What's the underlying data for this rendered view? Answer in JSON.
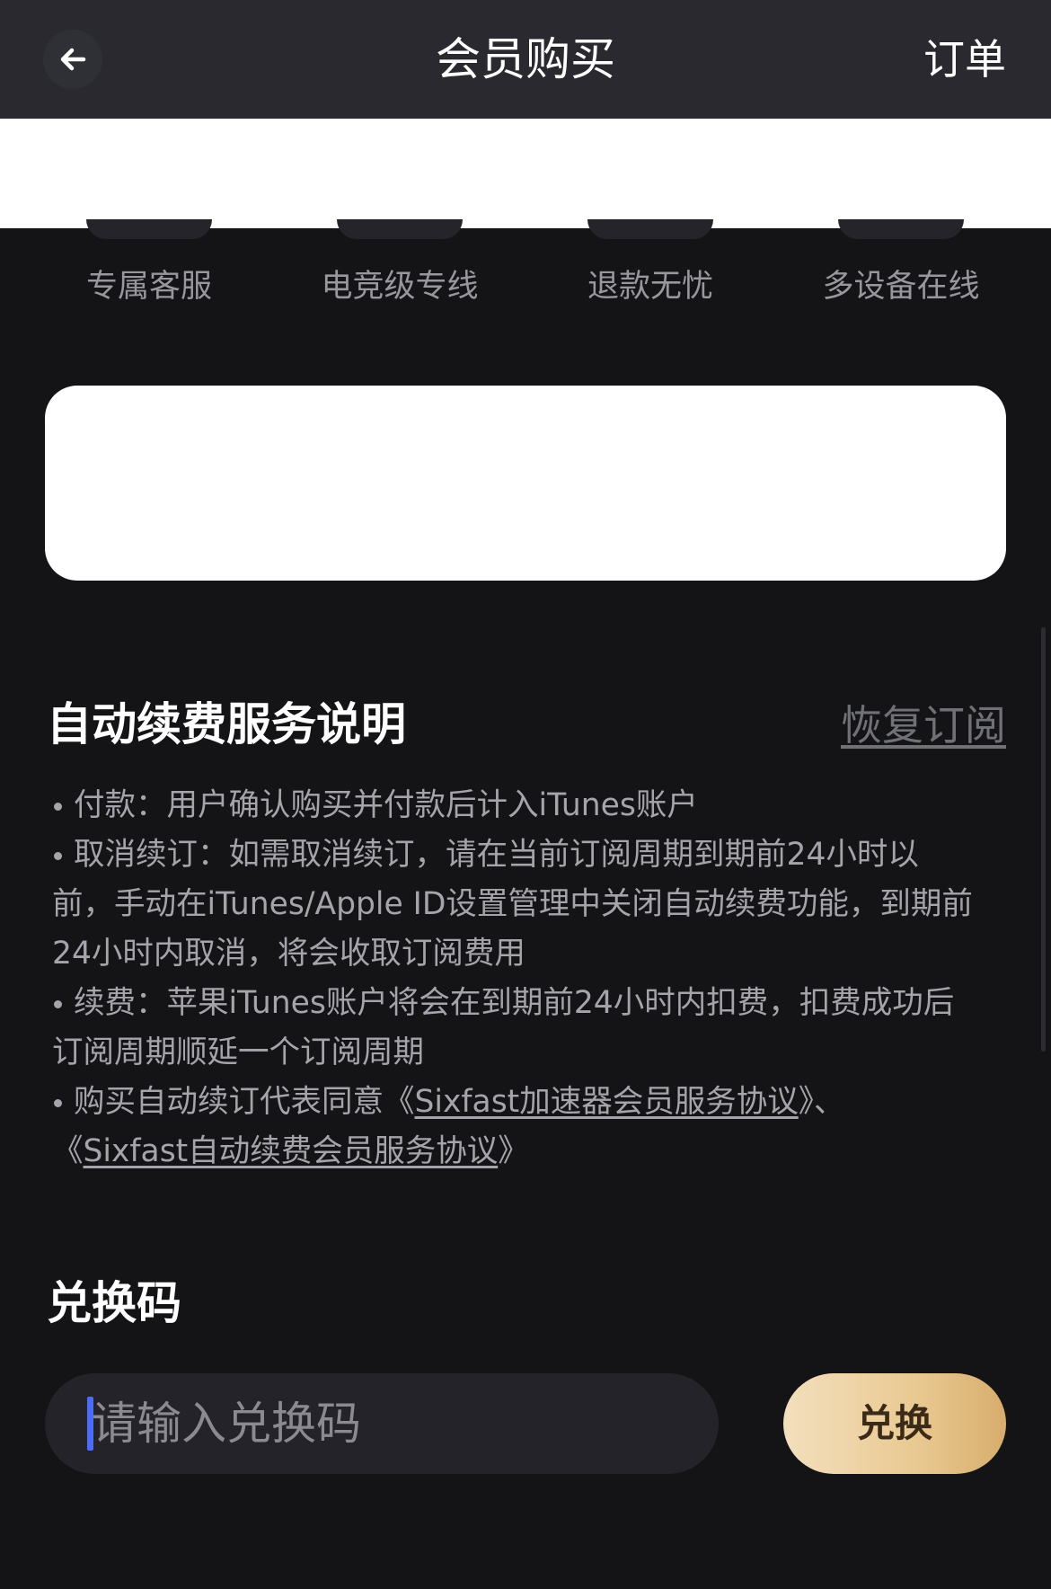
{
  "nav": {
    "title": "会员购买",
    "orders_label": "订单",
    "back_icon": "arrow-left-icon"
  },
  "features": [
    {
      "label": "专属客服"
    },
    {
      "label": "电竞级专线"
    },
    {
      "label": "退款无忧"
    },
    {
      "label": "多设备在线"
    }
  ],
  "renewal": {
    "title": "自动续费服务说明",
    "restore_label": "恢复订阅",
    "notes": {
      "payment": "付款：用户确认购买并付款后计入iTunes账户",
      "cancel_line1": "取消续订：如需取消续订，请在当前订阅周期到期前24小时以",
      "cancel_line2": "前，手动在iTunes/Apple ID设置管理中关闭自动续费功能，到期前",
      "cancel_line3": "24小时内取消，将会收取订阅费用",
      "fee_line1": "续费：苹果iTunes账户将会在到期前24小时内扣费，扣费成功后",
      "fee_line2": "订阅周期顺延一个订阅周期",
      "agree_prefix": "购买自动续订代表同意《",
      "agreement1": "Sixfast加速器会员服务协议",
      "agree_sep": "》、",
      "agree_open2": "《",
      "agreement2": "Sixfast自动续费会员服务协议",
      "agree_close2": "》"
    }
  },
  "redeem": {
    "title": "兑换码",
    "placeholder": "请输入兑换码",
    "button_label": "兑换"
  },
  "colors": {
    "background": "#141417",
    "nav_background": "#29292f",
    "accent_gold": "#e9c992",
    "caret_blue": "#4a6cf7"
  }
}
